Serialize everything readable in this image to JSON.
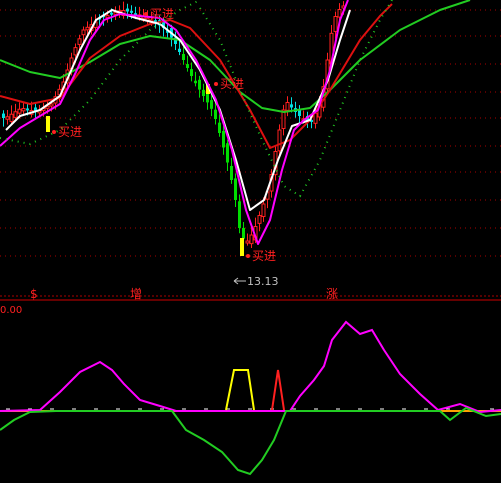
{
  "chart_data": [
    {
      "type": "candlestick",
      "panel": "main",
      "colors": {
        "up": "#ff2020",
        "down": "#00e0e0",
        "down_fill": "#00dd00",
        "bg": "#000000",
        "grid": "#aa0000"
      },
      "series": [
        {
          "name": "",
          "color": "#ffffff",
          "style": "line"
        },
        {
          "name": "",
          "color": "#ff00ff",
          "style": "line"
        },
        {
          "name": "",
          "color": "#dd1010",
          "style": "line"
        },
        {
          "name": "",
          "color": "#22cc22",
          "style": "line"
        },
        {
          "name": "",
          "color": "#22cc22",
          "style": "dotted"
        }
      ],
      "annotations": [
        {
          "text": "买进",
          "color": "#ff2020"
        },
        {
          "text": "买进",
          "color": "#ff2020"
        },
        {
          "text": "买进",
          "color": "#ff2020"
        },
        {
          "text": "买进",
          "color": "#ff2020"
        },
        {
          "text": "13.13",
          "color": "#c0c0c0"
        }
      ],
      "markers": [
        "$",
        "增",
        "涨"
      ]
    },
    {
      "type": "line",
      "panel": "indicator",
      "ylabel_value": "0.00",
      "series": [
        {
          "name": "",
          "color": "#ff00ff"
        },
        {
          "name": "",
          "color": "#22cc22"
        },
        {
          "name": "",
          "color": "#ffff00"
        },
        {
          "name": "",
          "color": "#ff2020"
        },
        {
          "name": "",
          "color": "#ffa000"
        }
      ]
    }
  ]
}
